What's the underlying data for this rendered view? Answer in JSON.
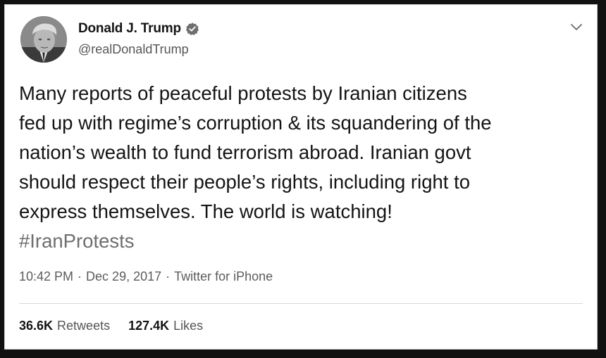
{
  "tweet": {
    "author": {
      "display_name": "Donald J. Trump",
      "handle": "@realDonaldTrump",
      "verified_icon": "verified-badge-icon"
    },
    "text": "Many reports of peaceful protests by Iranian citizens\nfed up with regime’s corruption & its squandering of the\nnation’s wealth to fund terrorism abroad. Iranian govt\nshould respect their people’s rights, including right to\nexpress themselves. The world is watching!",
    "hashtag": "#IranProtests",
    "time": "10:42 PM",
    "separator": "·",
    "date": "Dec 29, 2017",
    "source": "Twitter for iPhone",
    "retweets_count": "36.6K",
    "retweets_label": "Retweets",
    "likes_count": "127.4K",
    "likes_label": "Likes"
  },
  "colors": {
    "text": "#141414",
    "muted": "#5c5c5c",
    "hashtag": "#6e6e6e",
    "background": "#ffffff",
    "frame": "#111111"
  }
}
